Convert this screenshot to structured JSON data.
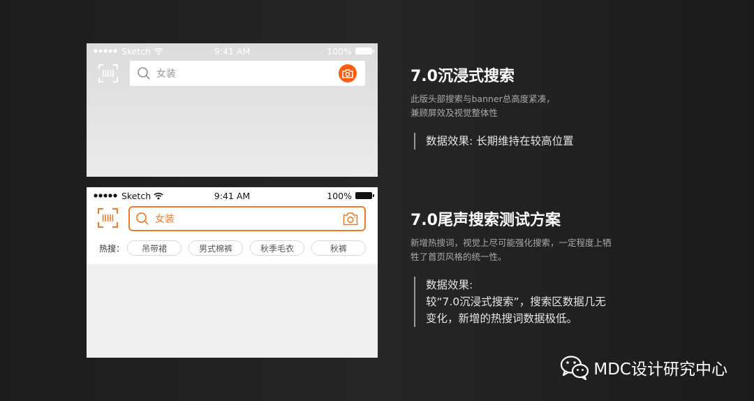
{
  "phone_old": {
    "status": {
      "carrier": "Sketch",
      "time": "9:41 AM",
      "battery": "100%"
    },
    "search": {
      "placeholder": "女装"
    }
  },
  "phone_new": {
    "status": {
      "carrier": "Sketch",
      "time": "9:41 AM",
      "battery": "100%"
    },
    "search": {
      "placeholder": "女装"
    },
    "hot": {
      "label": "热搜：",
      "chips": [
        "吊带裙",
        "男式棉裤",
        "秋季毛衣",
        "秋裤"
      ]
    }
  },
  "section1": {
    "title": "7.0沉浸式搜索",
    "desc": "此版头部搜索与banner总高度紧凑，\n兼顾屏效及视觉整体性",
    "effect": "数据效果: 长期维持在较高位置"
  },
  "section2": {
    "title": "7.0尾声搜索测试方案",
    "desc": "新增热搜词，视觉上尽可能强化搜索，一定程度上牺\n牲了首页风格的统一性。",
    "effect": "数据效果:\n较“7.0沉浸式搜索”，搜索区数据几无\n变化，新增的热搜词数据极低。"
  },
  "footer": {
    "brand": "MDC设计研究中心"
  },
  "colors": {
    "accent": "#f07a2b",
    "camera_button": "#ff5d0e",
    "background": "#1c1c1d"
  },
  "icons": [
    "signal-dots-icon",
    "wifi-icon",
    "battery-icon",
    "scan-icon",
    "search-icon",
    "camera-icon",
    "wechat-icon"
  ]
}
